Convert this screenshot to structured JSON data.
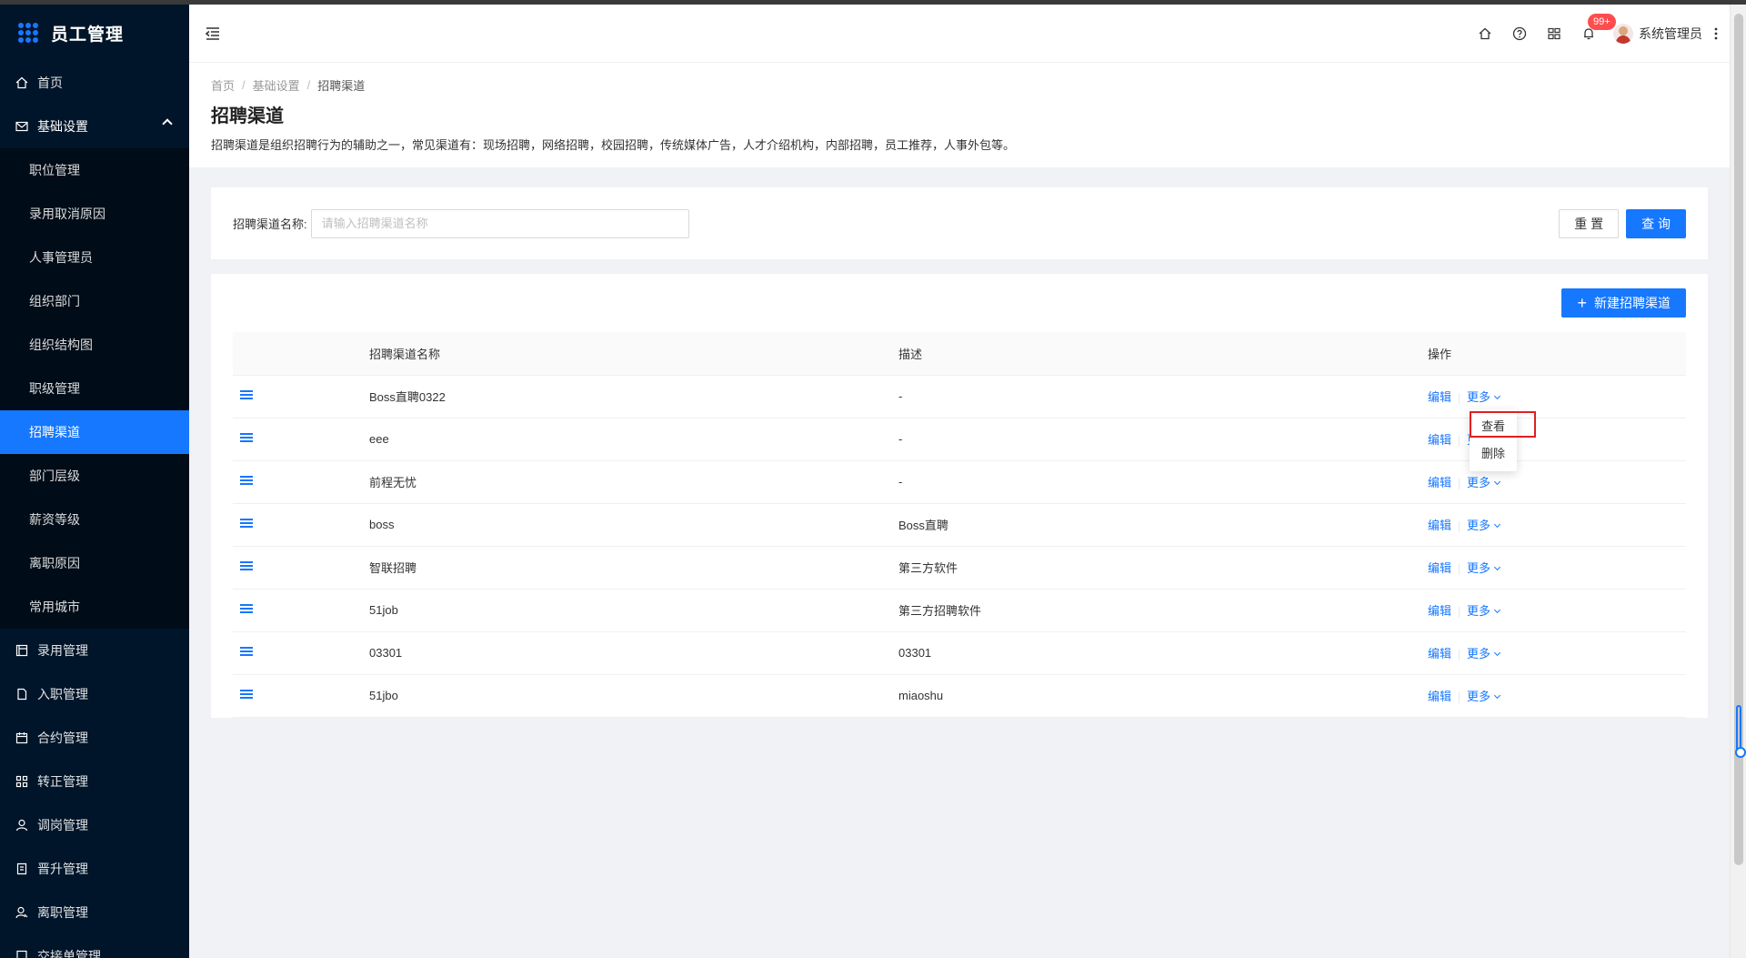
{
  "app": {
    "title": "员工管理"
  },
  "sidebar": {
    "items": [
      {
        "label": "首页",
        "icon": "home-icon"
      },
      {
        "label": "基础设置",
        "icon": "mail-icon",
        "open": true,
        "children": [
          "职位管理",
          "录用取消原因",
          "人事管理员",
          "组织部门",
          "组织结构图",
          "职级管理",
          "招聘渠道",
          "部门层级",
          "薪资等级",
          "离职原因",
          "常用城市"
        ],
        "active_child": "招聘渠道"
      },
      {
        "label": "录用管理",
        "icon": "form-icon"
      },
      {
        "label": "入职管理",
        "icon": "file-icon"
      },
      {
        "label": "合约管理",
        "icon": "calendar-icon"
      },
      {
        "label": "转正管理",
        "icon": "qrcode-icon"
      },
      {
        "label": "调岗管理",
        "icon": "user-icon"
      },
      {
        "label": "晋升管理",
        "icon": "audit-icon"
      },
      {
        "label": "离职管理",
        "icon": "user-leave-icon"
      },
      {
        "label": "交接单管理",
        "icon": "transfer-icon"
      }
    ]
  },
  "header": {
    "notification_badge": "99+",
    "user_name": "系统管理员"
  },
  "breadcrumb": [
    "首页",
    "基础设置",
    "招聘渠道"
  ],
  "page": {
    "title": "招聘渠道",
    "description": "招聘渠道是组织招聘行为的辅助之一，常见渠道有：现场招聘，网络招聘，校园招聘，传统媒体广告，人才介绍机构，内部招聘，员工推荐，人事外包等。"
  },
  "search": {
    "label": "招聘渠道名称:",
    "placeholder": "请输入招聘渠道名称",
    "value": "",
    "reset_label": "重 置",
    "query_label": "查 询"
  },
  "table": {
    "new_button_label": "新建招聘渠道",
    "columns": [
      "",
      "招聘渠道名称",
      "描述",
      "操作"
    ],
    "edit_label": "编辑",
    "more_label": "更多",
    "rows": [
      {
        "name": "Boss直聘0322",
        "desc": "-"
      },
      {
        "name": "eee",
        "desc": "-"
      },
      {
        "name": "前程无忧",
        "desc": "-"
      },
      {
        "name": "boss",
        "desc": "Boss直聘"
      },
      {
        "name": "智联招聘",
        "desc": "第三方软件"
      },
      {
        "name": "51job",
        "desc": "第三方招聘软件"
      },
      {
        "name": "03301",
        "desc": "03301"
      },
      {
        "name": "51jbo",
        "desc": "miaoshu"
      }
    ]
  },
  "dropdown": {
    "items": [
      "查看",
      "删除"
    ]
  },
  "colors": {
    "primary": "#1677ff",
    "sidebar_bg": "#001529",
    "submenu_bg": "#000c17",
    "badge": "#ff4d4f",
    "highlight": "#e02020"
  }
}
